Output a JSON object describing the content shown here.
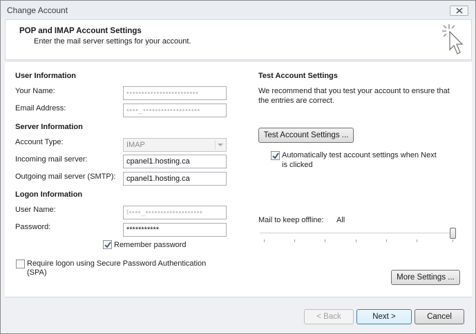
{
  "window": {
    "title": "Change Account"
  },
  "header": {
    "title": "POP and IMAP Account Settings",
    "subtitle": "Enter the mail server settings for your account."
  },
  "user_info": {
    "heading": "User Information",
    "name_label": "Your Name:",
    "name_value": "••••••••••••••••••••••••",
    "email_label": "Email Address:",
    "email_value": "••••_•••••••••••••••••••"
  },
  "server_info": {
    "heading": "Server Information",
    "account_type_label": "Account Type:",
    "account_type_value": "IMAP",
    "incoming_label": "Incoming mail server:",
    "incoming_value": "cpanel1.hosting.ca",
    "outgoing_label": "Outgoing mail server (SMTP):",
    "outgoing_value": "cpanel1.hosting.ca"
  },
  "logon_info": {
    "heading": "Logon Information",
    "username_label": "User Name:",
    "username_value": "t••••_•••••••••••••••••••",
    "password_label": "Password:",
    "password_value": "***********",
    "remember_label": "Remember password",
    "remember_checked": true,
    "spa_label_line1": "Require logon using Secure Password Authentication",
    "spa_label_line2": "(SPA)",
    "spa_checked": false
  },
  "test_settings": {
    "heading": "Test Account Settings",
    "desc_line1": "We recommend that you test your account to ensure that",
    "desc_line2": "the entries are correct.",
    "test_button": "Test Account Settings ...",
    "auto_test_line1": "Automatically test account settings when Next",
    "auto_test_line2": "is clicked",
    "auto_test_checked": true
  },
  "offline": {
    "label": "Mail to keep offline:",
    "value": "All"
  },
  "more_settings_button": "More Settings ...",
  "footer": {
    "back_label": "< Back",
    "next_label": "Next >",
    "cancel_label": "Cancel"
  }
}
